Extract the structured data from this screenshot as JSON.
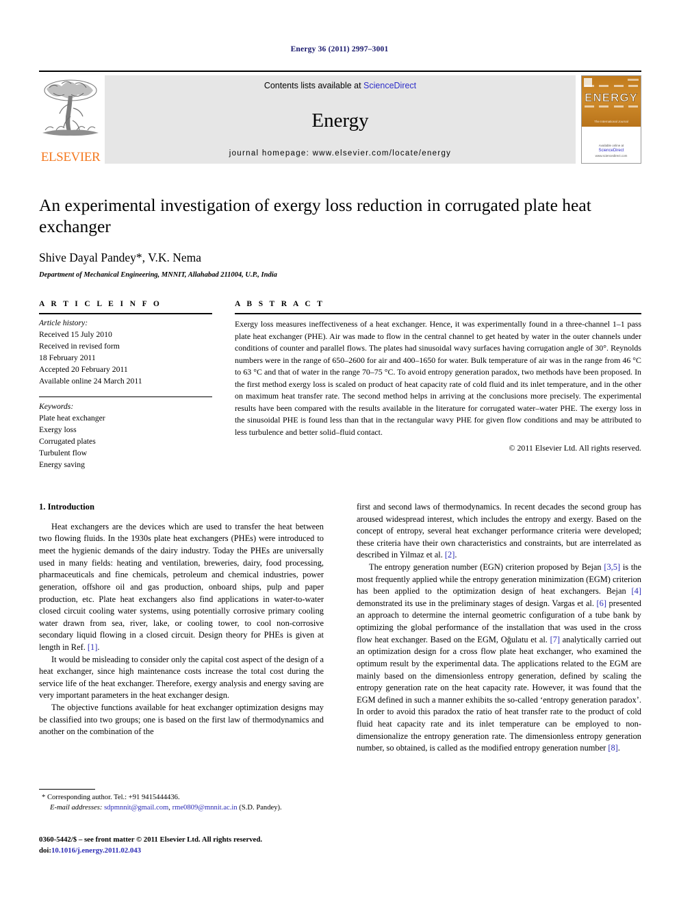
{
  "running_head": "Energy 36 (2011) 2997–3001",
  "masthead": {
    "publisher_name": "ELSEVIER",
    "contents_prefix": "Contents lists available at ",
    "contents_link": "ScienceDirect",
    "journal_title": "Energy",
    "homepage": "journal homepage: www.elsevier.com/locate/energy",
    "cover": {
      "word": "ENERGY",
      "subtitle": "The International Journal",
      "sd_prefix": "Available online at",
      "sd_main": "ScienceDirect",
      "sd_url": "www.sciencedirect.com"
    },
    "colors": {
      "elsevier_orange": "#f47920",
      "link_blue": "#2d2dc8",
      "masthead_gray": "#e6e6e6",
      "cover_orange": "#c8801f"
    }
  },
  "article": {
    "title": "An experimental investigation of exergy loss reduction in corrugated plate heat exchanger",
    "authors": "Shive Dayal Pandey*, V.K. Nema",
    "affiliation": "Department of Mechanical Engineering, MNNIT, Allahabad 211004, U.P., India"
  },
  "article_info": {
    "heading": "A R T I C L E  I N F O",
    "history_label": "Article history:",
    "history": [
      "Received 15 July 2010",
      "Received in revised form",
      "18 February 2011",
      "Accepted 20 February 2011",
      "Available online 24 March 2011"
    ],
    "keywords_label": "Keywords:",
    "keywords": [
      "Plate heat exchanger",
      "Exergy loss",
      "Corrugated plates",
      "Turbulent flow",
      "Energy saving"
    ]
  },
  "abstract": {
    "heading": "A B S T R A C T",
    "text": "Exergy loss measures ineffectiveness of a heat exchanger. Hence, it was experimentally found in a three-channel 1–1 pass plate heat exchanger (PHE). Air was made to flow in the central channel to get heated by water in the outer channels under conditions of counter and parallel flows. The plates had sinusoidal wavy surfaces having corrugation angle of 30°. Reynolds numbers were in the range of 650–2600 for air and 400–1650 for water. Bulk temperature of air was in the range from 46 °C to 63 °C and that of water in the range 70–75 °C. To avoid entropy generation paradox, two methods have been proposed. In the first method exergy loss is scaled on product of heat capacity rate of cold fluid and its inlet temperature, and in the other on maximum heat transfer rate. The second method helps in arriving at the conclusions more precisely. The experimental results have been compared with the results available in the literature for corrugated water–water PHE. The exergy loss in the sinusoidal PHE is found less than that in the rectangular wavy PHE for given flow conditions and may be attributed to less turbulence and better solid–fluid contact.",
    "copyright": "© 2011 Elsevier Ltd. All rights reserved."
  },
  "introduction": {
    "section_title": "1. Introduction",
    "left_paragraphs": [
      {
        "pre": "Heat exchangers are the devices which are used to transfer the heat between two flowing fluids. In the 1930s plate heat exchangers (PHEs) were introduced to meet the hygienic demands of the dairy industry. Today the PHEs are universally used in many fields: heating and ventilation, breweries, dairy, food processing, pharmaceuticals and fine chemicals, petroleum and chemical industries, power generation, offshore oil and gas production, onboard ships, pulp and paper production, etc. Plate heat exchangers also find applications in water-to-water closed circuit cooling water systems, using potentially corrosive primary cooling water drawn from sea, river, lake, or cooling tower, to cool non-corrosive secondary liquid flowing in a closed circuit. Design theory for PHEs is given at length in Ref. ",
        "ref": "[1]",
        "post": "."
      },
      {
        "pre": "It would be misleading to consider only the capital cost aspect of the design of a heat exchanger, since high maintenance costs increase the total cost during the service life of the heat exchanger. Therefore, exergy analysis and energy saving are very important parameters in the heat exchanger design.",
        "ref": "",
        "post": ""
      },
      {
        "pre": "The objective functions available for heat exchanger optimization designs may be classified into two groups; one is based on the first law of thermodynamics and another on the combination of the",
        "ref": "",
        "post": ""
      }
    ],
    "right_paragraphs": [
      {
        "pre": "first and second laws of thermodynamics. In recent decades the second group has aroused widespread interest, which includes the entropy and exergy. Based on the concept of entropy, several heat exchanger performance criteria were developed; these criteria have their own characteristics and constraints, but are interrelated as described in Yilmaz et al. ",
        "ref": "[2]",
        "post": ".",
        "no_indent": true
      },
      {
        "segments": [
          {
            "t": "The entropy generation number (EGN) criterion proposed by Bejan "
          },
          {
            "t": "[3,5]",
            "ref": true
          },
          {
            "t": " is the most frequently applied while the entropy generation minimization (EGM) criterion has been applied to the optimization design of heat exchangers. Bejan "
          },
          {
            "t": "[4]",
            "ref": true
          },
          {
            "t": " demonstrated its use in the preliminary stages of design. Vargas et al. "
          },
          {
            "t": "[6]",
            "ref": true
          },
          {
            "t": " presented an approach to determine the internal geometric configuration of a tube bank by optimizing the global performance of the installation that was used in the cross flow heat exchanger. Based on the EGM, Oğulatu et al. "
          },
          {
            "t": "[7]",
            "ref": true
          },
          {
            "t": " analytically carried out an optimization design for a cross flow plate heat exchanger, who examined the optimum result by the experimental data. The applications related to the EGM are mainly based on the dimensionless entropy generation, defined by scaling the entropy generation rate on the heat capacity rate. However, it was found that the EGM defined in such a manner exhibits the so-called ‘entropy generation paradox’. In order to avoid this paradox the ratio of heat transfer rate to the product of cold fluid heat capacity rate and its inlet temperature can be employed to non-dimensionalize the entropy generation rate. The dimensionless entropy generation number, so obtained, is called as the modified entropy generation number "
          },
          {
            "t": "[8]",
            "ref": true
          },
          {
            "t": "."
          }
        ]
      }
    ]
  },
  "footnote": {
    "corresponding": "* Corresponding author. Tel.: +91 9415444436.",
    "email_label": "E-mail addresses:",
    "email1": "sdpmnnit@gmail.com",
    "email_sep": ", ",
    "email2": "rme0809@mnnit.ac.in",
    "email_owner": " (S.D. Pandey)."
  },
  "imprint": {
    "line1": "0360-5442/$ – see front matter © 2011 Elsevier Ltd. All rights reserved.",
    "doi_label": "doi:",
    "doi_value": "10.1016/j.energy.2011.02.043"
  }
}
